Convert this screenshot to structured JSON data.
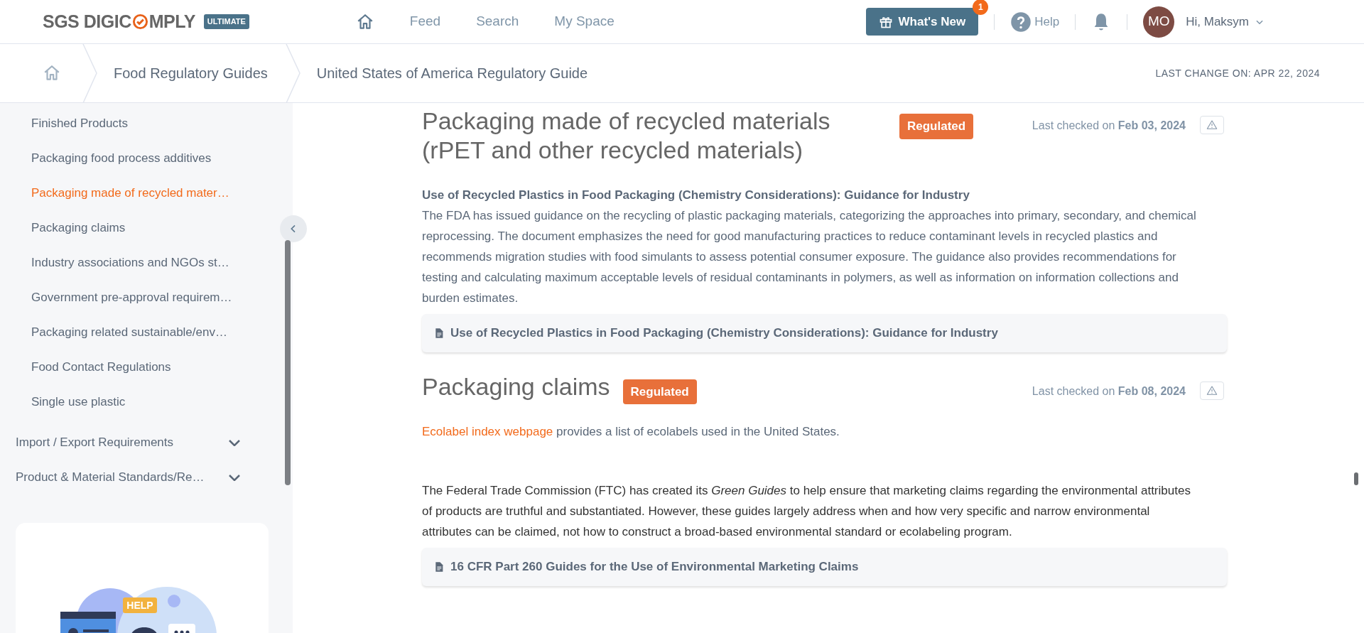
{
  "header": {
    "logo": {
      "before": "SGS DIGIC",
      "after": "MPLY"
    },
    "plan_badge": "ULTIMATE",
    "nav": [
      {
        "kind": "icon"
      },
      {
        "kind": "text",
        "label": "Feed"
      },
      {
        "kind": "text",
        "label": "Search"
      },
      {
        "kind": "text",
        "label": "My Space"
      }
    ],
    "whats_new": {
      "label": "What's New",
      "count": "1"
    },
    "help": "Help",
    "avatar": "MO",
    "greeting": "Hi, Maksym"
  },
  "breadcrumb": {
    "items": [
      "Food Regulatory Guides",
      "United States of America Regulatory Guide"
    ],
    "last_change": "LAST CHANGE ON: APR 22, 2024"
  },
  "sidebar": {
    "items": [
      {
        "label": "Finished Products",
        "selected": false
      },
      {
        "label": "Packaging food process additives",
        "selected": false
      },
      {
        "label": "Packaging made of recycled mater…",
        "selected": true
      },
      {
        "label": "Packaging claims",
        "selected": false
      },
      {
        "label": "Industry associations and NGOs st…",
        "selected": false
      },
      {
        "label": "Government pre-approval requirem…",
        "selected": false
      },
      {
        "label": "Packaging related sustainable/env…",
        "selected": false
      },
      {
        "label": "Food Contact Regulations",
        "selected": false
      },
      {
        "label": "Single use plastic",
        "selected": false
      }
    ],
    "groups": [
      {
        "label": "Import / Export Requirements",
        "expanded": false
      },
      {
        "label": "Product & Material Standards/Re…",
        "expanded": false
      }
    ],
    "help_card": {
      "tag": "HELP"
    }
  },
  "sections": [
    {
      "title": "Packaging made of recycled materials (rPET and other recycled materials)",
      "status": "Regulated",
      "checked_prefix": "Last checked on",
      "checked_date": "Feb 03, 2024",
      "blocks": [
        {
          "kind": "heading",
          "text": "Use of Recycled Plastics in Food Packaging (Chemistry Considerations): Guidance for Industry"
        },
        {
          "kind": "muted",
          "text": "The FDA has issued guidance on the recycling of plastic packaging materials, categorizing the approaches into primary, secondary, and chemical reprocessing. The document emphasizes the need for good manufacturing practices to reduce contaminant levels in recycled plastics and recommends migration studies with food simulants to assess potential consumer exposure. The guidance also provides recommendations for testing and calculating maximum acceptable levels of residual contaminants in polymers, as well as information on information collections and burden estimates."
        }
      ],
      "document": "Use of Recycled Plastics in Food Packaging (Chemistry Considerations): Guidance for Industry"
    },
    {
      "title": "Packaging claims",
      "status": "Regulated",
      "checked_prefix": "Last checked on",
      "checked_date": "Feb 08, 2024",
      "blocks": [
        {
          "kind": "link",
          "link": "Ecolabel index webpage",
          "text": "provides a list of ecolabels used in the United States."
        },
        {
          "kind": "dark",
          "text": "The Federal Trade Commission (FTC) has created its *Green Guides* to help ensure that marketing claims regarding the environmental attributes of products are truthful and substantiated. However, these guides largely address when and how very specific and narrow environmental attributes can be claimed, not how to construct a broad-based environmental standard or ecolabeling program."
        }
      ],
      "document": "16 CFR Part 260 Guides for the Use of Environmental Marketing Claims"
    }
  ]
}
